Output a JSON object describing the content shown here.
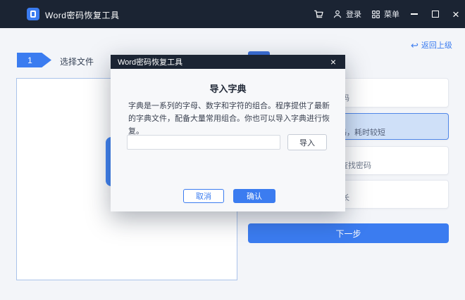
{
  "titlebar": {
    "app_title": "Word密码恢复工具",
    "login_label": "登录",
    "menu_label": "菜单",
    "close_glyph": "×"
  },
  "steps": {
    "step1_number": "1",
    "step1_label": "选择文件"
  },
  "back_link": {
    "arrow_glyph": "↩",
    "label": "返回上级"
  },
  "modal": {
    "title": "Word密码恢复工具",
    "close_glyph": "×",
    "heading": "导入字典",
    "description": "字典是一系列的字母、数字和字符的组合。程序提供了最新的字典文件，配备大量常用组合。你也可以导入字典进行恢复。",
    "input_value": "",
    "input_placeholder": "",
    "import_button": "导入",
    "cancel_button": "取消",
    "confirm_button": "确认"
  },
  "right_panel": {
    "cards": [
      {
        "visible_fragment": "码",
        "highlighted": false
      },
      {
        "visible_fragment": "码，耗时较短",
        "highlighted": true
      },
      {
        "visible_fragment": "查找密码",
        "highlighted": false
      },
      {
        "visible_fragment": "长",
        "highlighted": false
      }
    ],
    "next_button": "下一步"
  },
  "colors": {
    "accent_blue": "#3b7cf0",
    "titlebar_bg": "#1b2433",
    "page_bg": "#f3f5f9",
    "highlight_card_bg": "#cfe0f8",
    "highlight_card_border": "#4f86e8",
    "panel_border": "#aac3ea"
  }
}
